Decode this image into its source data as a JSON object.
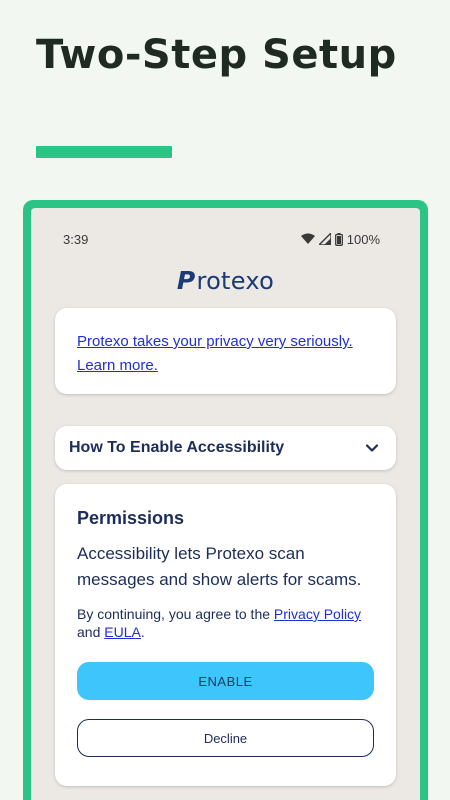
{
  "headline": "Two-Step Setup",
  "colors": {
    "accent": "#29c486",
    "navy": "#1c2d5a",
    "link": "#1e2fd6",
    "enable_button": "#3ec5fb"
  },
  "status_bar": {
    "time": "3:39",
    "battery": "100%",
    "icons": [
      "wifi-icon",
      "signal-icon",
      "battery-icon"
    ]
  },
  "app": {
    "logo_initial": "P",
    "logo_rest": "rotexo"
  },
  "privacy": {
    "line1": "Protexo takes your privacy very seriously.",
    "line2": "Learn more."
  },
  "accordion": {
    "title": "How To Enable Accessibility",
    "icon": "chevron-down-icon"
  },
  "permissions": {
    "title": "Permissions",
    "description": "Accessibility lets Protexo scan messages and show alerts for scams.",
    "legal_prefix": "By continuing, you agree to the ",
    "privacy_policy_link": "Privacy Policy",
    "legal_and": " and ",
    "eula_link": "EULA",
    "legal_suffix": ".",
    "enable_label": "ENABLE",
    "decline_label": "Decline"
  }
}
